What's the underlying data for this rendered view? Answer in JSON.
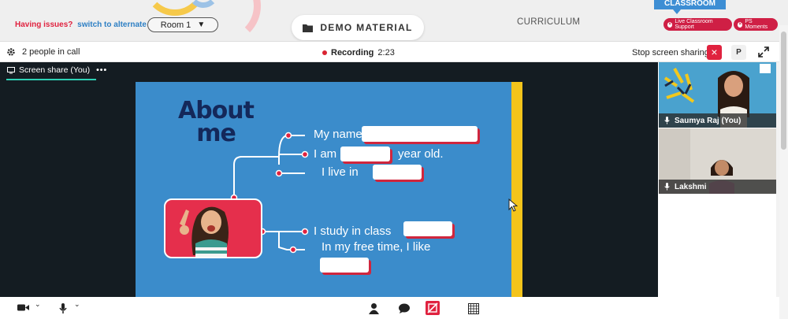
{
  "topbar": {
    "issues_label": "Having issues?",
    "switch_link": "switch to alternate room",
    "room_value": "Room 1",
    "demo_label": "DEMO MATERIAL",
    "curriculum_label": "CURRICULUM",
    "classroom_tab": "CLASSROOM",
    "live_support_label": "Live Classroom Support",
    "ps_moments_label": "PS Moments"
  },
  "call": {
    "people_count": "2 people in call",
    "recording_label": "Recording",
    "recording_time": "2:23",
    "stop_share_label": "Stop screen sharing",
    "p_button_label": "P",
    "screen_share_tab": "Screen share (You)"
  },
  "slide": {
    "title_line1": "About",
    "title_line2": "me",
    "name_line": "My name is",
    "age_prefix": "I am",
    "age_suffix": "year old.",
    "live_line": "I live in",
    "class_line": "I study in class",
    "free_line": "In my free time, I like"
  },
  "participants": [
    {
      "name": "Saumya Raj (You)"
    },
    {
      "name": "Lakshmi"
    }
  ],
  "colors": {
    "accent_red": "#e0223f",
    "slide_blue": "#3b8ccb",
    "title_navy": "#14285a",
    "tab_teal": "#2ed1b5",
    "stage_dark": "#141c22"
  },
  "icons": [
    "gear-icon",
    "close-icon",
    "expand-icon",
    "folder-icon",
    "chevron-down-icon",
    "camera-icon",
    "microphone-icon",
    "person-icon",
    "chat-icon",
    "whiteboard-off-icon",
    "grid-icon",
    "screen-share-icon",
    "more-icon"
  ]
}
